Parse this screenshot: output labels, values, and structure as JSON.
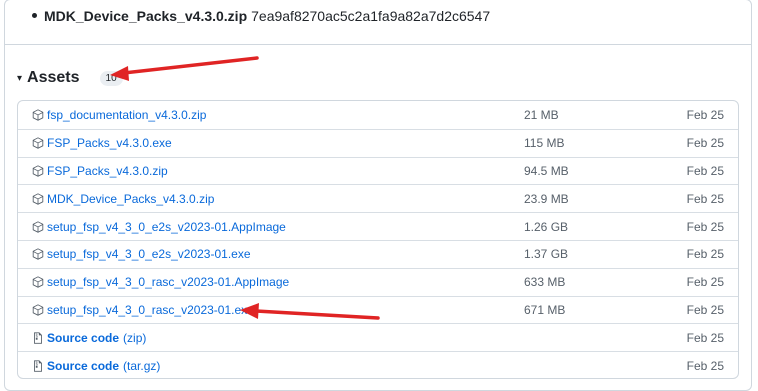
{
  "previous_item": {
    "filename": "MDK_Device_Packs_v4.3.0.zip",
    "hash": "7ea9af8270ac5c2a1fa9a82a7d2c6547"
  },
  "assets": {
    "caret": "▾",
    "title": "Assets",
    "count": "10"
  },
  "files": [
    {
      "name": "fsp_documentation_v4.3.0.zip",
      "size": "21 MB",
      "date": "Feb 25",
      "icon": "package-icon"
    },
    {
      "name": "FSP_Packs_v4.3.0.exe",
      "size": "115 MB",
      "date": "Feb 25",
      "icon": "package-icon"
    },
    {
      "name": "FSP_Packs_v4.3.0.zip",
      "size": "94.5 MB",
      "date": "Feb 25",
      "icon": "package-icon"
    },
    {
      "name": "MDK_Device_Packs_v4.3.0.zip",
      "size": "23.9 MB",
      "date": "Feb 25",
      "icon": "package-icon"
    },
    {
      "name": "setup_fsp_v4_3_0_e2s_v2023-01.AppImage",
      "size": "1.26 GB",
      "date": "Feb 25",
      "icon": "package-icon"
    },
    {
      "name": "setup_fsp_v4_3_0_e2s_v2023-01.exe",
      "size": "1.37 GB",
      "date": "Feb 25",
      "icon": "package-icon"
    },
    {
      "name": "setup_fsp_v4_3_0_rasc_v2023-01.AppImage",
      "size": "633 MB",
      "date": "Feb 25",
      "icon": "package-icon"
    },
    {
      "name": "setup_fsp_v4_3_0_rasc_v2023-01.exe",
      "size": "671 MB",
      "date": "Feb 25",
      "icon": "package-icon"
    }
  ],
  "source": [
    {
      "name": "Source code",
      "format": "(zip)",
      "date": "Feb 25",
      "icon": "file-zip-icon"
    },
    {
      "name": "Source code",
      "format": "(tar.gz)",
      "date": "Feb 25",
      "icon": "file-zip-icon"
    }
  ],
  "colors": {
    "link": "#0969da",
    "annotation_arrow": "#e02424"
  }
}
